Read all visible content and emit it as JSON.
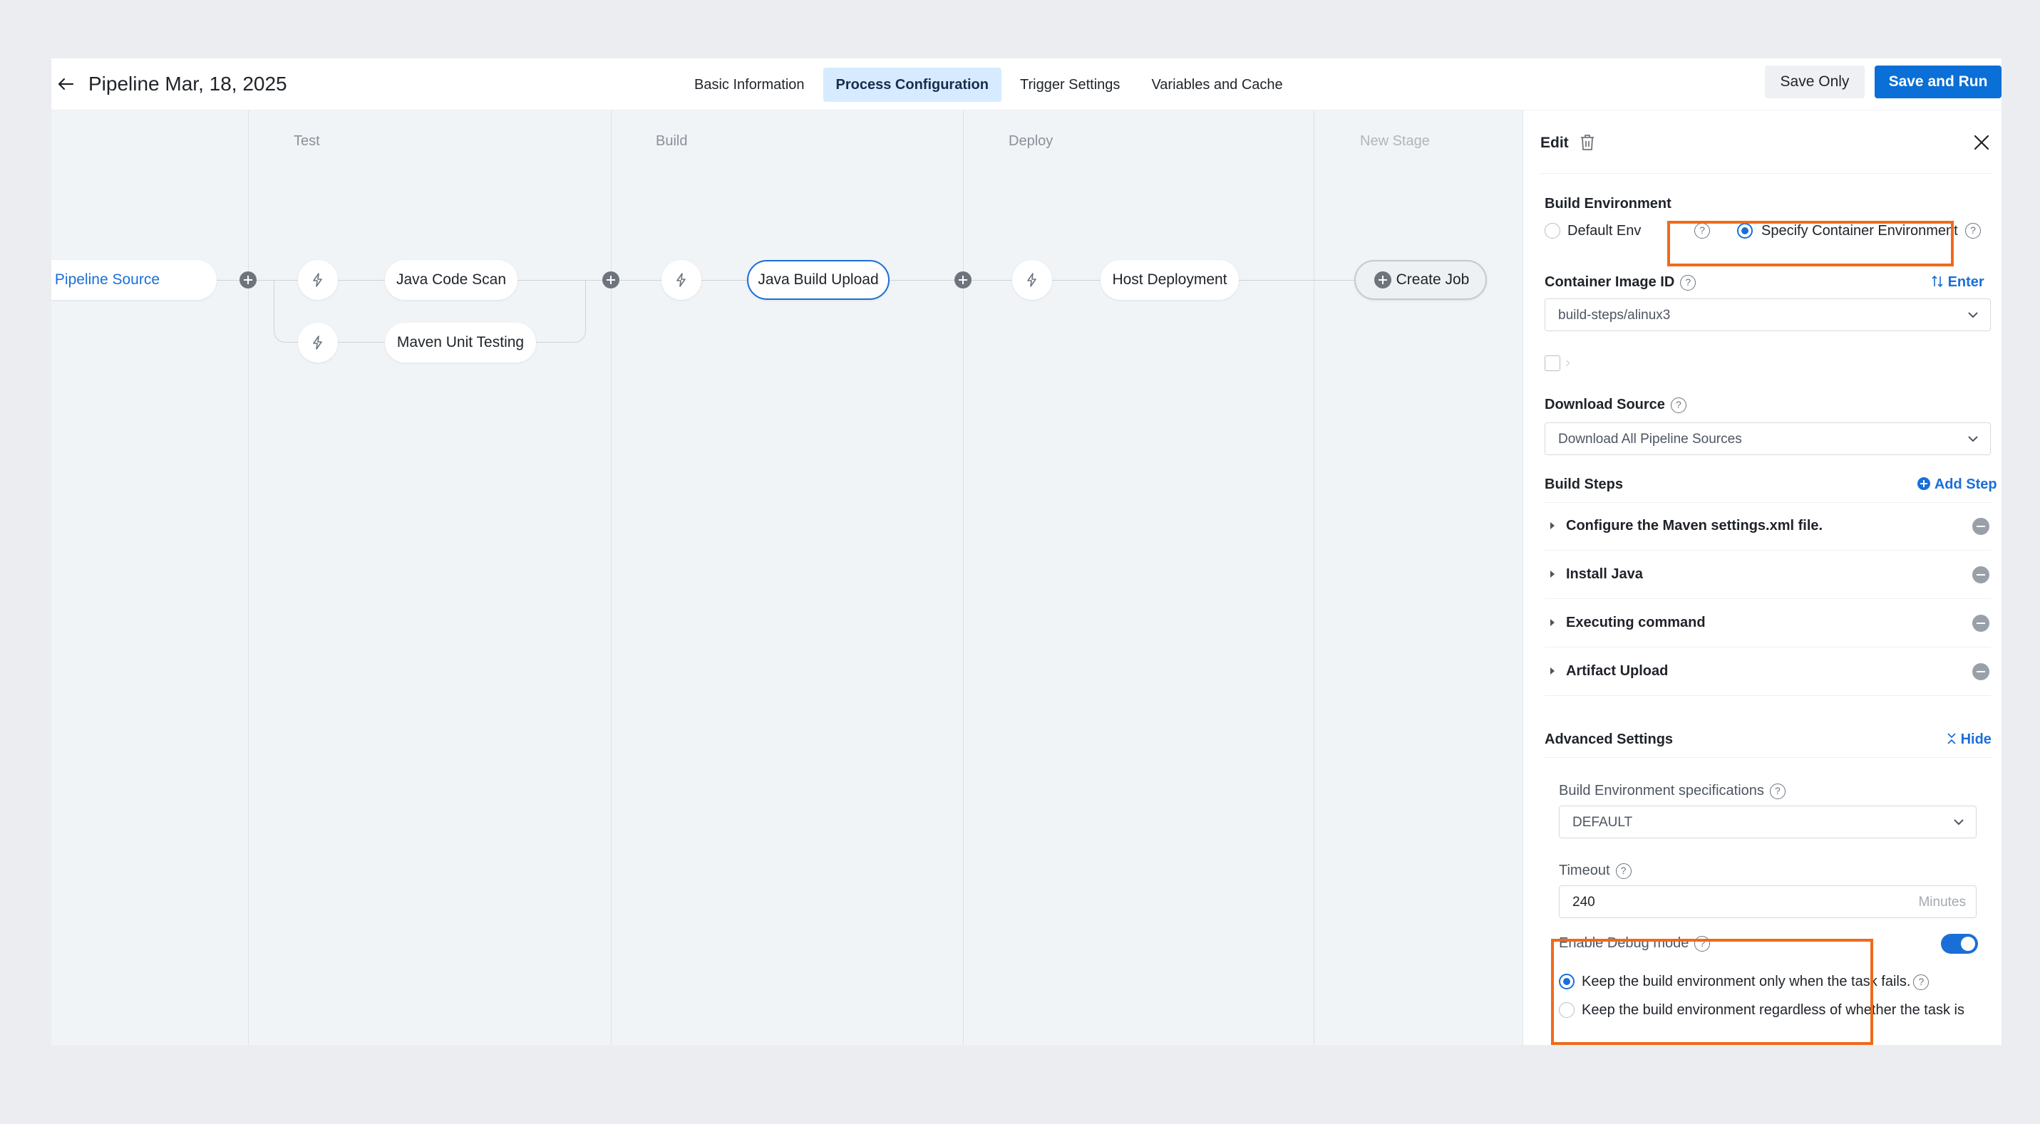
{
  "header": {
    "title": "Pipeline Mar, 18, 2025",
    "tabs": [
      {
        "label": "Basic Information",
        "active": false
      },
      {
        "label": "Process Configuration",
        "active": true
      },
      {
        "label": "Trigger Settings",
        "active": false
      },
      {
        "label": "Variables and Cache",
        "active": false
      }
    ],
    "save_only": "Save Only",
    "save_and_run": "Save and Run"
  },
  "canvas": {
    "source_label": "d Pipeline Source",
    "stages": [
      {
        "title": "Test",
        "jobs": [
          "Java Code Scan",
          "Maven Unit Testing"
        ]
      },
      {
        "title": "Build",
        "jobs": [
          "Java Build Upload"
        ]
      },
      {
        "title": "Deploy",
        "jobs": [
          "Host Deployment"
        ]
      },
      {
        "title": "New Stage",
        "create_job": "Create Job"
      }
    ]
  },
  "panel": {
    "title": "Edit",
    "build_env": {
      "label": "Build Environment",
      "options": [
        "Default Env",
        "Specify Container Environment"
      ],
      "selected": "Specify Container Environment"
    },
    "container_image": {
      "label": "Container Image ID",
      "enter_link": "Enter",
      "value": "build-steps/alinux3"
    },
    "download_source": {
      "label": "Download Source",
      "value": "Download All Pipeline Sources"
    },
    "build_steps": {
      "label": "Build Steps",
      "add_link": "Add Step",
      "steps": [
        "Configure the Maven settings.xml file.",
        "Install Java",
        "Executing command",
        "Artifact Upload"
      ]
    },
    "advanced": {
      "label": "Advanced Settings",
      "hide_link": "Hide",
      "spec_label": "Build Environment specifications",
      "spec_value": "DEFAULT",
      "timeout_label": "Timeout",
      "timeout_value": "240",
      "timeout_unit": "Minutes",
      "debug_label": "Enable Debug mode",
      "debug_enabled": true,
      "debug_options": [
        "Keep the build environment only when the task fails.",
        "Keep the build environment regardless of whether the task is"
      ]
    }
  },
  "colors": {
    "accent": "#1a6fd6",
    "annotation": "#f06a1a"
  }
}
